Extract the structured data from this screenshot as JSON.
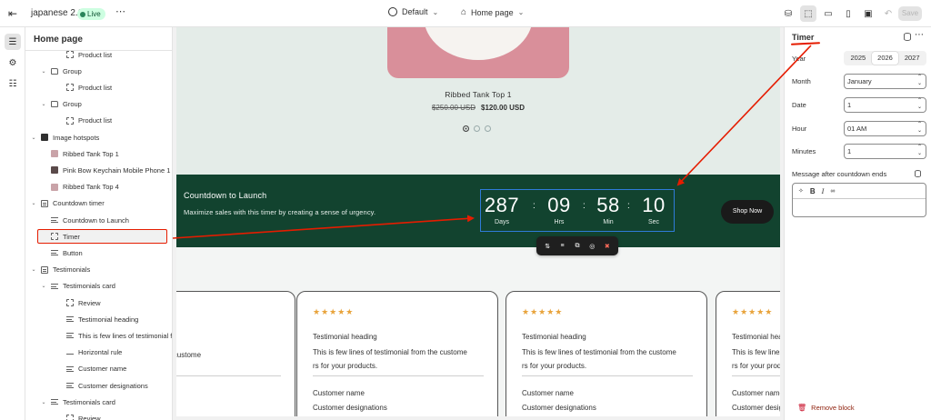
{
  "topbar": {
    "store_name": "japanese 2.0",
    "status": "Live",
    "theme": "Default",
    "page": "Home page",
    "save_label": "Save"
  },
  "left_panel": {
    "title": "Home page",
    "items": [
      {
        "label": "Product list",
        "icon": "block-icon",
        "indent": 2,
        "caret": false
      },
      {
        "label": "Group",
        "icon": "folder-icon",
        "indent": 1,
        "caret": true
      },
      {
        "label": "Product list",
        "icon": "block-icon",
        "indent": 2,
        "caret": false
      },
      {
        "label": "Group",
        "icon": "folder-icon",
        "indent": 1,
        "caret": true
      },
      {
        "label": "Product list",
        "icon": "block-icon",
        "indent": 2,
        "caret": false
      },
      {
        "label": "Image hotspots",
        "icon": "section-dark-icon",
        "indent": 0,
        "caret": true
      },
      {
        "label": "Ribbed Tank Top 1",
        "icon": "image-icon",
        "indent": 1,
        "caret": false
      },
      {
        "label": "Pink Bow Keychain Mobile Phone 1",
        "icon": "image-dark-icon",
        "indent": 1,
        "caret": false
      },
      {
        "label": "Ribbed Tank Top 4",
        "icon": "image-icon",
        "indent": 1,
        "caret": false
      },
      {
        "label": "Countdown timer",
        "icon": "section-icon",
        "indent": 0,
        "caret": true
      },
      {
        "label": "Countdown to Launch",
        "icon": "text-icon",
        "indent": 1,
        "caret": false
      },
      {
        "label": "Timer",
        "icon": "block-icon",
        "indent": 1,
        "caret": false,
        "selected": true
      },
      {
        "label": "Button",
        "icon": "button-icon",
        "indent": 1,
        "caret": false
      },
      {
        "label": "Testimonials",
        "icon": "section-icon",
        "indent": 0,
        "caret": true
      },
      {
        "label": "Testimonials card",
        "icon": "text-icon",
        "indent": 1,
        "caret": true
      },
      {
        "label": "Review",
        "icon": "block-icon",
        "indent": 2,
        "caret": false
      },
      {
        "label": "Testimonial heading",
        "icon": "text-icon",
        "indent": 2,
        "caret": false
      },
      {
        "label": "This is few lines of testimonial fr...",
        "icon": "text-icon",
        "indent": 2,
        "caret": false
      },
      {
        "label": "Horizontal rule",
        "icon": "hr-icon",
        "indent": 2,
        "caret": false
      },
      {
        "label": "Customer name",
        "icon": "text-icon",
        "indent": 2,
        "caret": false
      },
      {
        "label": "Customer designations",
        "icon": "text-icon",
        "indent": 2,
        "caret": false
      },
      {
        "label": "Testimonials card",
        "icon": "text-icon",
        "indent": 1,
        "caret": true
      },
      {
        "label": "Review",
        "icon": "block-icon",
        "indent": 2,
        "caret": false
      }
    ]
  },
  "preview": {
    "product": {
      "name": "Ribbed Tank Top 1",
      "price_old": "$250.00 USD",
      "price_new": "$120.00 USD",
      "slide_count": 3,
      "active_slide": 1
    },
    "countdown": {
      "title": "Countdown to Launch",
      "subtitle": "Maximize sales with this timer by creating a sense of urgency.",
      "units": [
        {
          "value": "287",
          "label": "Days"
        },
        {
          "value": "09",
          "label": "Hrs"
        },
        {
          "value": "58",
          "label": "Min"
        },
        {
          "value": "10",
          "label": "Sec"
        }
      ],
      "button": "Shop Now"
    },
    "testimonials": [
      {
        "stars": "★★★★★",
        "heading": "",
        "body": "estimonial from the custome",
        "body2": "",
        "name": "",
        "designation": "ns"
      },
      {
        "stars": "★★★★★",
        "heading": "Testimonial heading",
        "body": "This is few lines of testimonial from the custome",
        "body2": "rs for your products.",
        "name": "Customer name",
        "designation": "Customer designations"
      },
      {
        "stars": "★★★★★",
        "heading": "Testimonial heading",
        "body": "This is few lines of testimonial from the custome",
        "body2": "rs for your products.",
        "name": "Customer name",
        "designation": "Customer designations"
      },
      {
        "stars": "★★★★★",
        "heading": "Testimonial heading",
        "body": "This is few lines of testimonial from the custome",
        "body2": "rs for your products.",
        "name": "Customer name",
        "designation": "Customer designations"
      }
    ]
  },
  "right_panel": {
    "title": "Timer",
    "year_label": "Year",
    "year_options": [
      "2025",
      "2026",
      "2027"
    ],
    "year_selected": "2026",
    "month_label": "Month",
    "month_value": "January",
    "date_label": "Date",
    "date_value": "1",
    "hour_label": "Hour",
    "hour_value": "01 AM",
    "minutes_label": "Minutes",
    "minutes_value": "1",
    "message_label": "Message after countdown ends",
    "message_value": "",
    "remove_label": "Remove block"
  },
  "colors": {
    "annotation": "#e51c00",
    "countdown_bg": "#12432f",
    "timer_outline": "#2f7bd8",
    "star": "#e8a33b"
  }
}
